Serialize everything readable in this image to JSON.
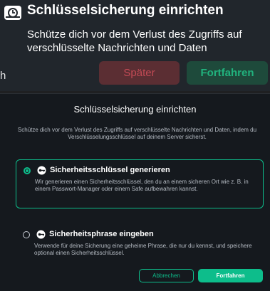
{
  "toast": {
    "title": "Schlüsselsicherung einrichten",
    "body": "Schütze dich vor dem Verlust des Zugriffs auf verschlüsselte Nachrichten und Daten",
    "later_label": "Später",
    "continue_label": "Fortfahren",
    "icon": "key-backup-icon"
  },
  "background_fragment": "h",
  "dialog": {
    "title": "Schlüsselsicherung einrichten",
    "description": "Schütze dich vor dem Verlust des Zugriffs auf verschlüsselte Nachrichten und Daten, indem du Verschlüsselungsschlüssel auf deinem Server sicherst.",
    "options": [
      {
        "title": "Sicherheitsschlüssel generieren",
        "description": "Wir generieren einen Sicherheitsschlüssel, den du an einem sicheren Ort wie z. B. in einem Passwort-Manager oder einem Safe aufbewahren kannst.",
        "selected": true,
        "icon": "key-icon"
      },
      {
        "title": "Sicherheitsphrase eingeben",
        "description": "Verwende für deine Sicherung eine geheime Phrase, die nur du kennst, und speichere optional einen Sicherheitsschlüssel.",
        "selected": false,
        "icon": "key-icon"
      }
    ],
    "cancel_label": "Abbrechen",
    "confirm_label": "Fortfahren"
  },
  "colors": {
    "accent": "#0dbd8b",
    "danger": "#c24a55",
    "dialog_bg": "#15191e"
  }
}
